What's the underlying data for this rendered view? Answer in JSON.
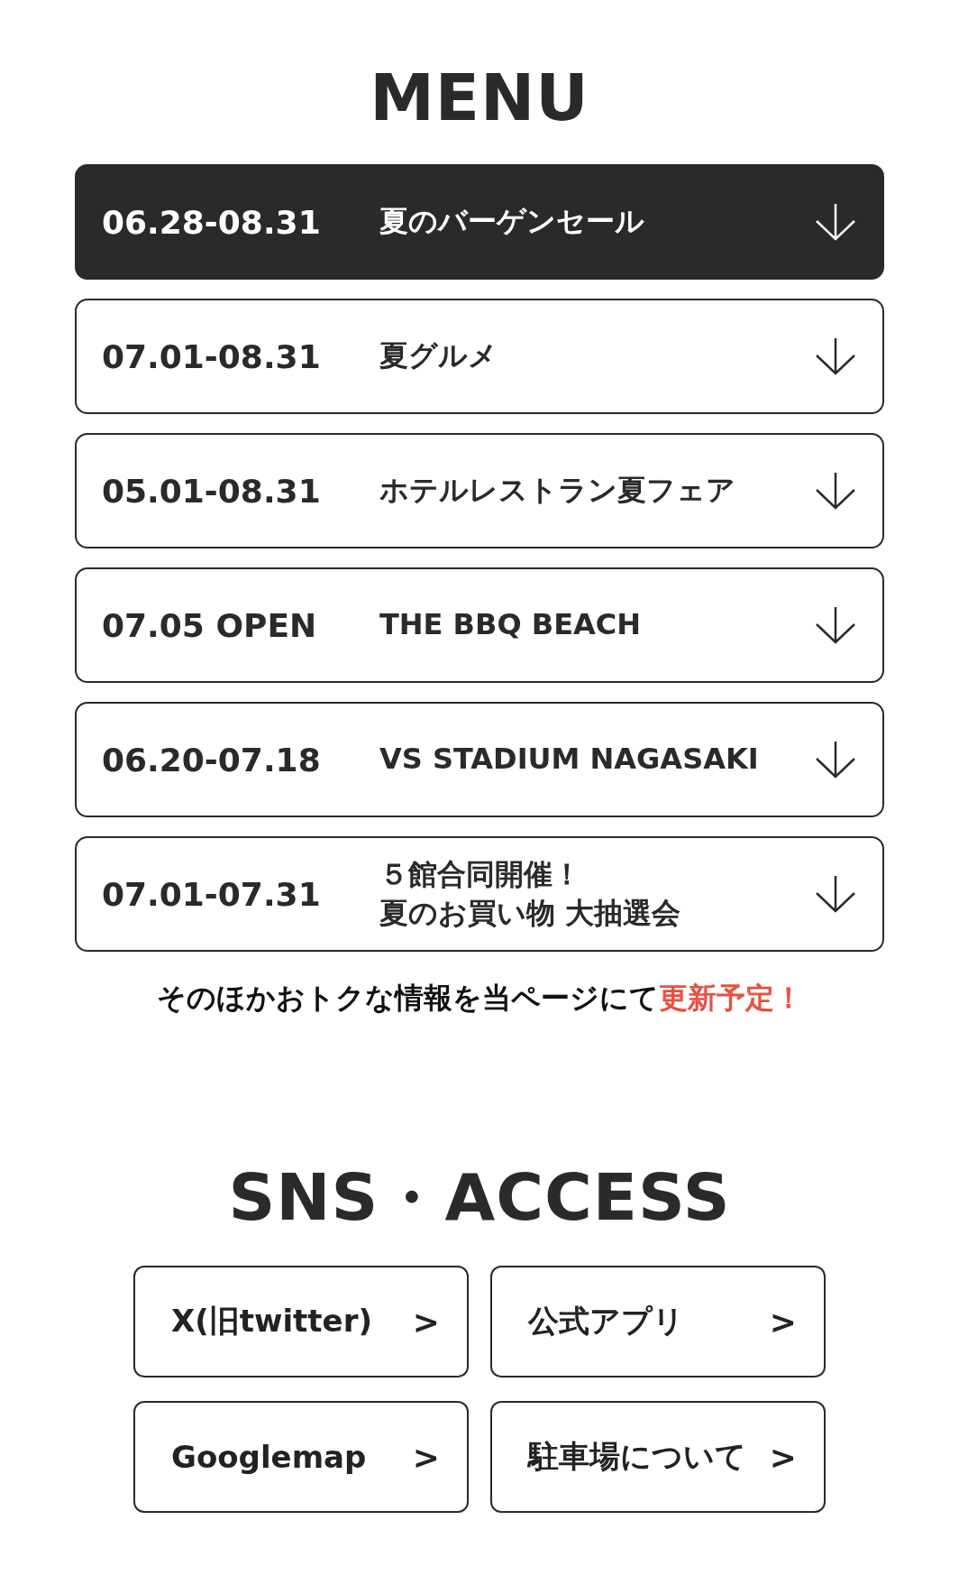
{
  "menu": {
    "title": "MENU",
    "items": [
      {
        "date": "06.28-08.31",
        "title": "夏のバーゲンセール",
        "selected": true
      },
      {
        "date": "07.01-08.31",
        "title": "夏グルメ",
        "selected": false
      },
      {
        "date": "05.01-08.31",
        "title": "ホテルレストラン夏フェア",
        "selected": false
      },
      {
        "date": "07.05 OPEN",
        "title": "THE BBQ BEACH",
        "selected": false
      },
      {
        "date": "06.20-07.18",
        "title": "VS STADIUM NAGASAKI",
        "selected": false
      },
      {
        "date": "07.01-07.31",
        "title": "５館合同開催！",
        "subtitle": "夏のお買い物 大抽選会",
        "selected": false
      }
    ],
    "notice": {
      "text": "そのほかおトクな情報を当ページにて",
      "highlight": "更新予定！"
    }
  },
  "sns": {
    "title": "SNS・ACCESS",
    "links": [
      {
        "label": "X(旧twitter)",
        "arrow": ">"
      },
      {
        "label": "公式アプリ",
        "arrow": ">"
      },
      {
        "label": "Googlemap",
        "arrow": ">"
      },
      {
        "label": "駐車場について",
        "arrow": ">"
      }
    ]
  }
}
